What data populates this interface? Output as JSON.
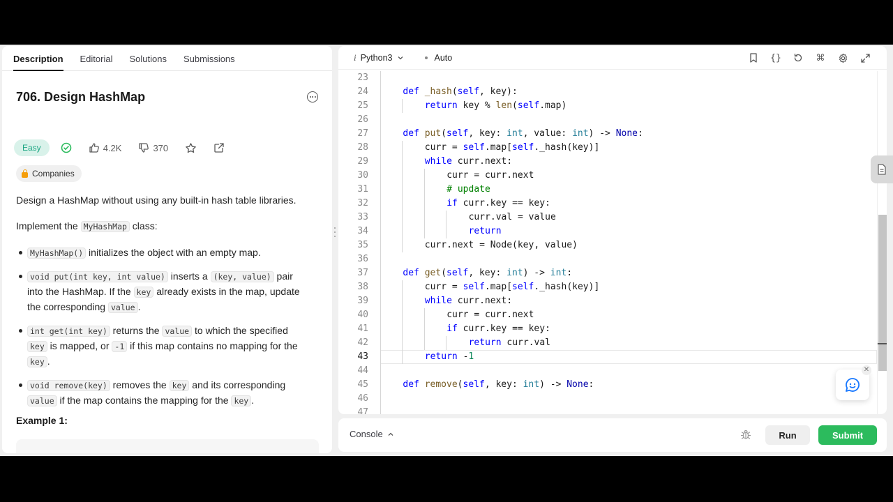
{
  "left_tabs": [
    "Description",
    "Editorial",
    "Solutions",
    "Submissions"
  ],
  "problem": {
    "title": "706. Design HashMap",
    "difficulty": "Easy",
    "likes": "4.2K",
    "dislikes": "370",
    "companies_label": "Companies"
  },
  "description": {
    "p1": "Design a HashMap without using any built-in hash table libraries.",
    "p2_pre": "Implement the ",
    "p2_code": "MyHashMap",
    "p2_post": " class:",
    "b1_code": "MyHashMap()",
    "b1_text": " initializes the object with an empty map.",
    "b2_code1": "void put(int key, int value)",
    "b2_t1": " inserts a ",
    "b2_code2": "(key, value)",
    "b2_t2": " pair into the HashMap. If the ",
    "b2_code3": "key",
    "b2_t3": " already exists in the map, update the corresponding ",
    "b2_code4": "value",
    "b2_t4": ".",
    "b3_code1": "int get(int key)",
    "b3_t1": " returns the ",
    "b3_code2": "value",
    "b3_t2": " to which the specified ",
    "b3_code3": "key",
    "b3_t3": " is mapped, or ",
    "b3_code4": "-1",
    "b3_t4": " if this map contains no mapping for the ",
    "b3_code5": "key",
    "b3_t5": ".",
    "b4_code1": "void remove(key)",
    "b4_t1": " removes the ",
    "b4_code2": "key",
    "b4_t2": " and its corresponding ",
    "b4_code3": "value",
    "b4_t3": " if the map contains the mapping for the ",
    "b4_code4": "key",
    "b4_t4": "."
  },
  "example_title": "Example 1:",
  "editor": {
    "language": "Python3",
    "lang_prefix": "i",
    "mode": "Auto",
    "current_line": 43,
    "lines": [
      {
        "n": 23,
        "indent": 1,
        "html": ""
      },
      {
        "n": 24,
        "indent": 1,
        "html": "<span class='k'>def</span> <span class='fn'>_hash</span>(<span class='sf'>self</span>, key):"
      },
      {
        "n": 25,
        "indent": 2,
        "html": "<span class='k'>return</span> key % <span class='bi'>len</span>(<span class='sf'>self</span>.map)"
      },
      {
        "n": 26,
        "indent": 1,
        "html": ""
      },
      {
        "n": 27,
        "indent": 1,
        "html": "<span class='k'>def</span> <span class='fn'>put</span>(<span class='sf'>self</span>, key: <span class='ty'>int</span>, value: <span class='ty'>int</span>) -&gt; <span class='k2'>None</span>:"
      },
      {
        "n": 28,
        "indent": 2,
        "html": "curr = <span class='sf'>self</span>.map[<span class='sf'>self</span>._hash(key)]"
      },
      {
        "n": 29,
        "indent": 2,
        "html": "<span class='k'>while</span> curr.next:"
      },
      {
        "n": 30,
        "indent": 3,
        "html": "curr = curr.next"
      },
      {
        "n": 31,
        "indent": 3,
        "html": "<span class='cm'># update</span>"
      },
      {
        "n": 32,
        "indent": 3,
        "html": "<span class='k'>if</span> curr.key == key:"
      },
      {
        "n": 33,
        "indent": 4,
        "html": "curr.val = value"
      },
      {
        "n": 34,
        "indent": 4,
        "html": "<span class='k'>return</span>"
      },
      {
        "n": 35,
        "indent": 2,
        "html": "curr.next = Node(key, value)"
      },
      {
        "n": 36,
        "indent": 1,
        "html": ""
      },
      {
        "n": 37,
        "indent": 1,
        "html": "<span class='k'>def</span> <span class='fn'>get</span>(<span class='sf'>self</span>, key: <span class='ty'>int</span>) -&gt; <span class='ty'>int</span>:"
      },
      {
        "n": 38,
        "indent": 2,
        "html": "curr = <span class='sf'>self</span>.map[<span class='sf'>self</span>._hash(key)]"
      },
      {
        "n": 39,
        "indent": 2,
        "html": "<span class='k'>while</span> curr.next:"
      },
      {
        "n": 40,
        "indent": 3,
        "html": "curr = curr.next"
      },
      {
        "n": 41,
        "indent": 3,
        "html": "<span class='k'>if</span> curr.key == key:"
      },
      {
        "n": 42,
        "indent": 4,
        "html": "<span class='k'>return</span> curr.val"
      },
      {
        "n": 43,
        "indent": 2,
        "html": "<span class='k'>return</span> -<span class='nm'>1</span>"
      },
      {
        "n": 44,
        "indent": 1,
        "html": ""
      },
      {
        "n": 45,
        "indent": 1,
        "html": "<span class='k'>def</span> <span class='fn'>remove</span>(<span class='sf'>self</span>, key: <span class='ty'>int</span>) -&gt; <span class='k2'>None</span>:"
      },
      {
        "n": 46,
        "indent": 1,
        "html": ""
      },
      {
        "n": 47,
        "indent": 1,
        "html": ""
      }
    ]
  },
  "console": {
    "label": "Console",
    "run": "Run",
    "submit": "Submit"
  },
  "colors": {
    "accent_green": "#2cbb5d",
    "easy": "#1ea784"
  }
}
